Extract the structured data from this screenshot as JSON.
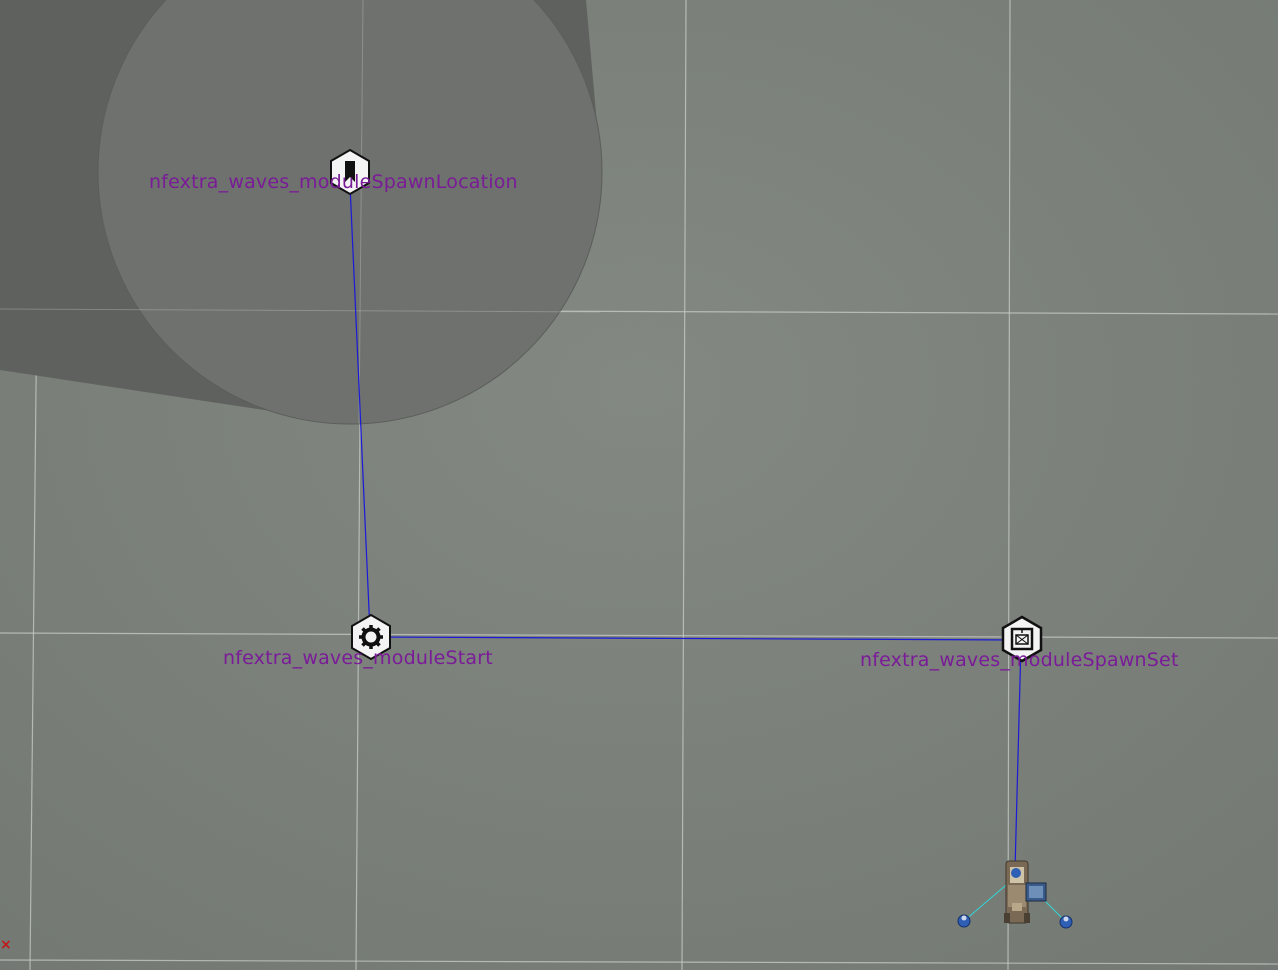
{
  "scene": {
    "colors": {
      "ground": "#7b807b",
      "ground_dark": "#6f746f",
      "grid_line": "#c9cdc9",
      "shadow_band": "#5f625e",
      "cylinder_top": "#6e716d",
      "cylinder_edge": "#5a5d59",
      "connection_line": "#1a1ad8",
      "label": "#7a1b98",
      "icon_fill": "#f4f4f4",
      "icon_stroke": "#111111",
      "origin_marker": "#c01a1a"
    },
    "modules": [
      {
        "id": "spawn-location",
        "label": "nfextra_waves_moduleSpawnLocation",
        "icon": "spawn-location-icon"
      },
      {
        "id": "start",
        "label": "nfextra_waves_moduleStart",
        "icon": "gear-icon"
      },
      {
        "id": "spawn-set",
        "label": "nfextra_waves_moduleSpawnSet",
        "icon": "spawn-set-icon"
      }
    ],
    "unit": {
      "icon": "vehicle-unit-icon"
    },
    "origin_marker": {
      "symbol": "×",
      "icon": "origin-x-icon"
    }
  }
}
